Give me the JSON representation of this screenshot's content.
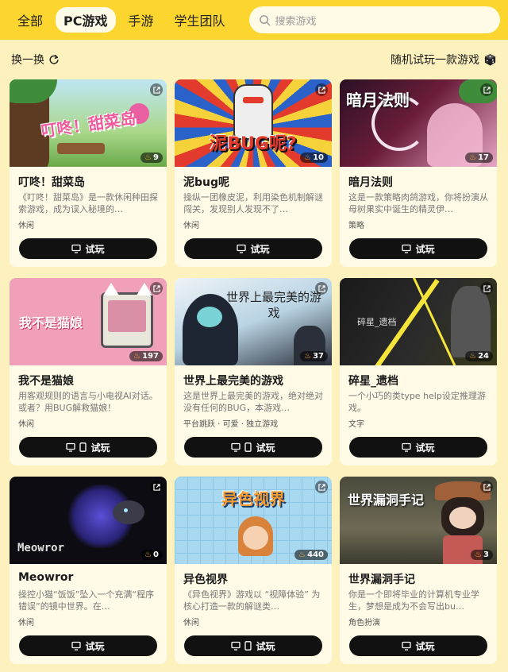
{
  "tabs": [
    {
      "label": "全部",
      "active": false
    },
    {
      "label": "PC游戏",
      "active": true
    },
    {
      "label": "手游",
      "active": false
    },
    {
      "label": "学生团队",
      "active": false
    }
  ],
  "search": {
    "placeholder": "搜索游戏"
  },
  "subbar": {
    "refresh_label": "换一换",
    "random_label": "随机试玩一款游戏"
  },
  "play_label": "试玩",
  "colors": {
    "accent": "#fcd62f",
    "page_bg": "#fdf1bd",
    "card_bg": "#fffbe6",
    "button_bg": "#111111"
  },
  "games": [
    {
      "title": "叮咚！甜菜岛",
      "desc": "《叮咚！甜菜岛》是一款休闲种田探索游戏，成为误入秘境的…",
      "tags": "休闲",
      "heat": "9",
      "dual_icon": false,
      "art_text": "叮咚！甜菜岛"
    },
    {
      "title": "泥bug呢",
      "desc": "操纵一团橡皮泥，利用染色机制解谜闯关，发现别人发现不了…",
      "tags": "休闲",
      "heat": "10",
      "dual_icon": false,
      "art_text": "泥BUG呢?"
    },
    {
      "title": "暗月法则",
      "desc": "这是一款策略肉鸽游戏，你将扮演从母树果实中诞生的精灵伊…",
      "tags": "策略",
      "heat": "17",
      "dual_icon": false,
      "art_text": "暗月法则"
    },
    {
      "title": "我不是猫娘",
      "desc": "用客观规则的语言与小电视AI对话。或者？用BUG解救猫娘！",
      "tags": "休闲",
      "heat": "197",
      "dual_icon": true,
      "art_text": "我不是猫娘"
    },
    {
      "title": "世界上最完美的游戏",
      "desc": "这是世界上最完美的游戏，绝对绝对没有任何的BUG，本游戏…",
      "tags": "平台跳跃 · 可爱 · 独立游戏",
      "heat": "37",
      "dual_icon": true,
      "art_text": "世界上最完美的游戏"
    },
    {
      "title": "碎星_遗档",
      "desc": "一个小巧的类type help设定推理游戏。",
      "tags": "文字",
      "heat": "24",
      "dual_icon": false,
      "art_text": "碎星_遗档"
    },
    {
      "title": "Meowror",
      "desc": "操控小猫“饭饭”坠入一个充满“程序错误”的镜中世界。在…",
      "tags": "休闲",
      "heat": "0",
      "dual_icon": false,
      "art_text": "Meowror"
    },
    {
      "title": "异色视界",
      "desc": "《异色视界》游戏以 “视障体验” 为核心打造一款的解谜类…",
      "tags": "休闲",
      "heat": "440",
      "dual_icon": true,
      "art_text": "异色视界"
    },
    {
      "title": "世界漏洞手记",
      "desc": "你是一个即将毕业的计算机专业学生，梦想是成为不会写出bu…",
      "tags": "角色扮演",
      "heat": "3",
      "dual_icon": false,
      "art_text": "世界漏洞手记"
    }
  ]
}
